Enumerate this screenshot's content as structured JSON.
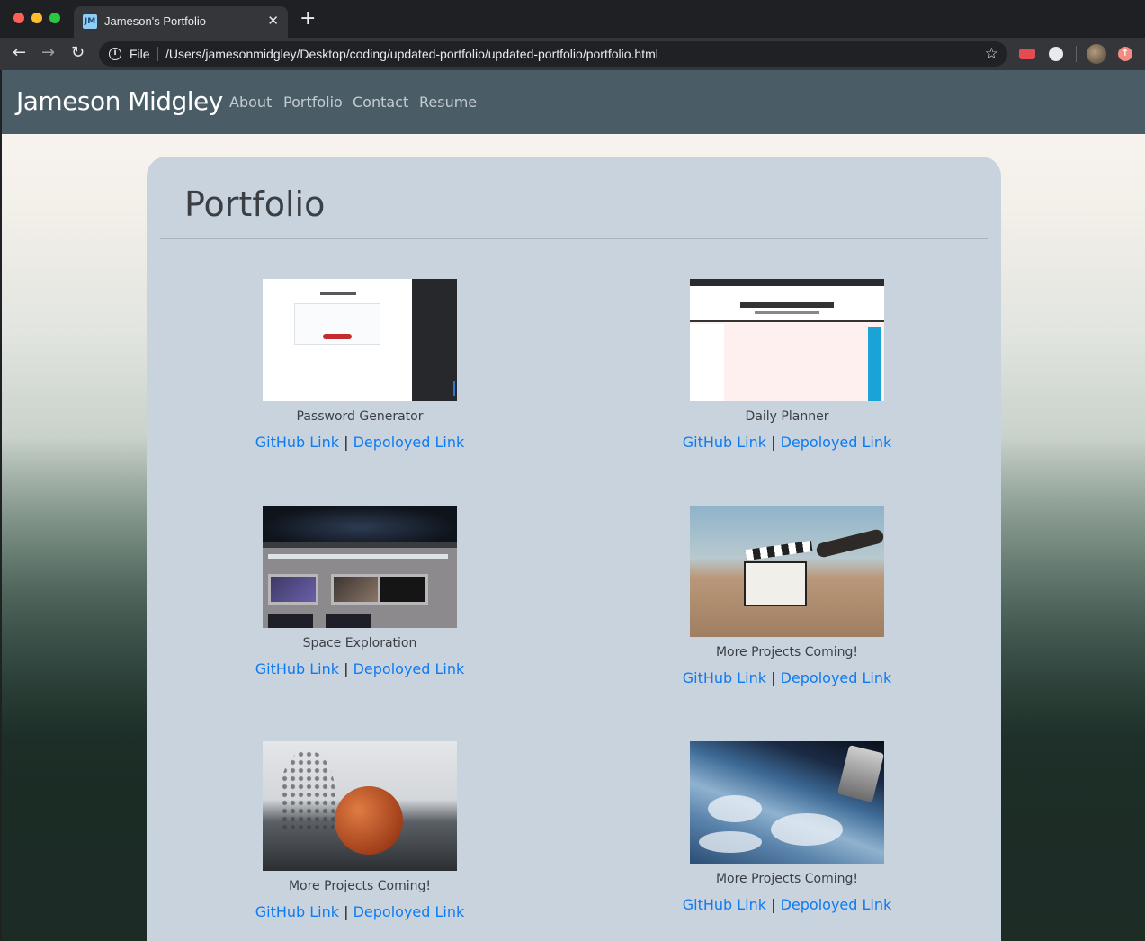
{
  "browser": {
    "tab_title": "Jameson's Portfolio",
    "tab_favicon_text": "JM",
    "url_scheme": "File",
    "url": "/Users/jamesonmidgley/Desktop/coding/updated-portfolio/updated-portfolio/portfolio.html"
  },
  "site": {
    "brand": "Jameson Midgley",
    "nav": [
      "About",
      "Portfolio",
      "Contact",
      "Resume"
    ]
  },
  "page": {
    "title": "Portfolio",
    "link_separator": "|",
    "projects": [
      {
        "caption": "Password Generator",
        "github_label": "GitHub Link",
        "deployed_label": "Depoloyed Link"
      },
      {
        "caption": "Daily Planner",
        "github_label": "GitHub Link",
        "deployed_label": "Depoloyed Link"
      },
      {
        "caption": "Space Exploration",
        "github_label": "GitHub Link",
        "deployed_label": "Depoloyed Link"
      },
      {
        "caption": "More Projects Coming!",
        "github_label": "GitHub Link",
        "deployed_label": "Depoloyed Link"
      },
      {
        "caption": "More Projects Coming!",
        "github_label": "GitHub Link",
        "deployed_label": "Depoloyed Link"
      },
      {
        "caption": "More Projects Coming!",
        "github_label": "GitHub Link",
        "deployed_label": "Depoloyed Link"
      }
    ]
  },
  "icons": {
    "back": "arrow-left-icon",
    "forward": "arrow-right-icon",
    "reload": "reload-icon",
    "info": "info-icon",
    "bookmark": "star-icon",
    "tab_close": "close-icon",
    "new_tab": "plus-icon"
  },
  "colors": {
    "navbar": "#4a5d66",
    "panel": "#c9d3de",
    "link": "#0d7bf2"
  }
}
